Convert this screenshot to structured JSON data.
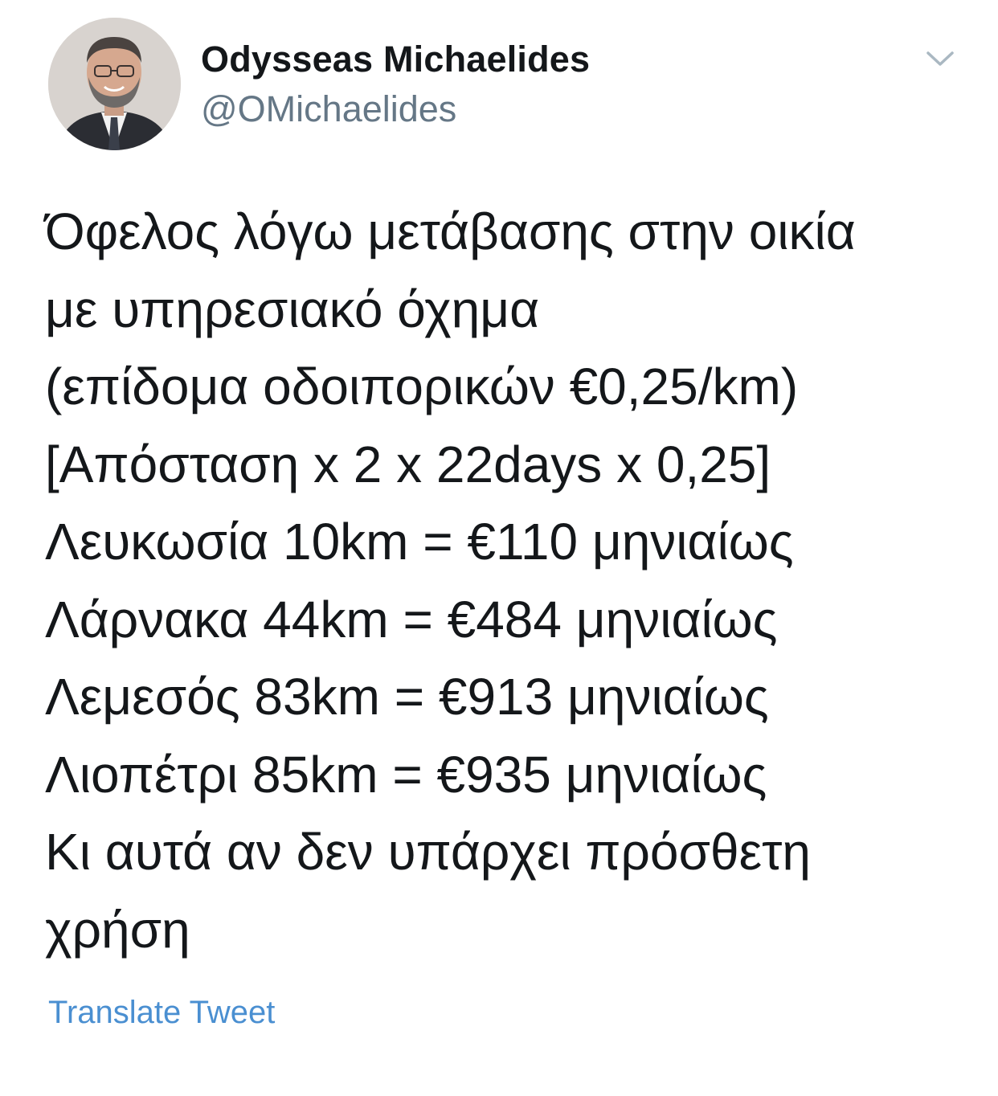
{
  "author": {
    "name": "Odysseas Michaelides",
    "handle": "@OMichaelides",
    "avatar_icon": "person-avatar"
  },
  "header": {
    "menu_icon": "chevron-down-icon"
  },
  "tweet": {
    "lines": [
      "Όφελος λόγω μετάβασης στην οικία",
      "με υπηρεσιακό όχημα",
      "(επίδομα οδοιπορικών €0,25/km)",
      "[Απόσταση x 2 x 22days x 0,25]",
      "Λευκωσία 10km = €110 μηνιαίως",
      "Λάρνακα 44km = €484 μηνιαίως",
      "Λεμεσός 83km = €913 μηνιαίως",
      "Λιοπέτρι 85km = €935 μηνιαίως",
      "Κι αυτά αν δεν υπάρχει πρόσθετη",
      "χρήση"
    ]
  },
  "actions": {
    "translate_label": "Translate Tweet"
  },
  "colors": {
    "text": "#14171a",
    "secondary": "#657786",
    "link": "#4a8fd1",
    "chevron": "#aab8c2"
  }
}
